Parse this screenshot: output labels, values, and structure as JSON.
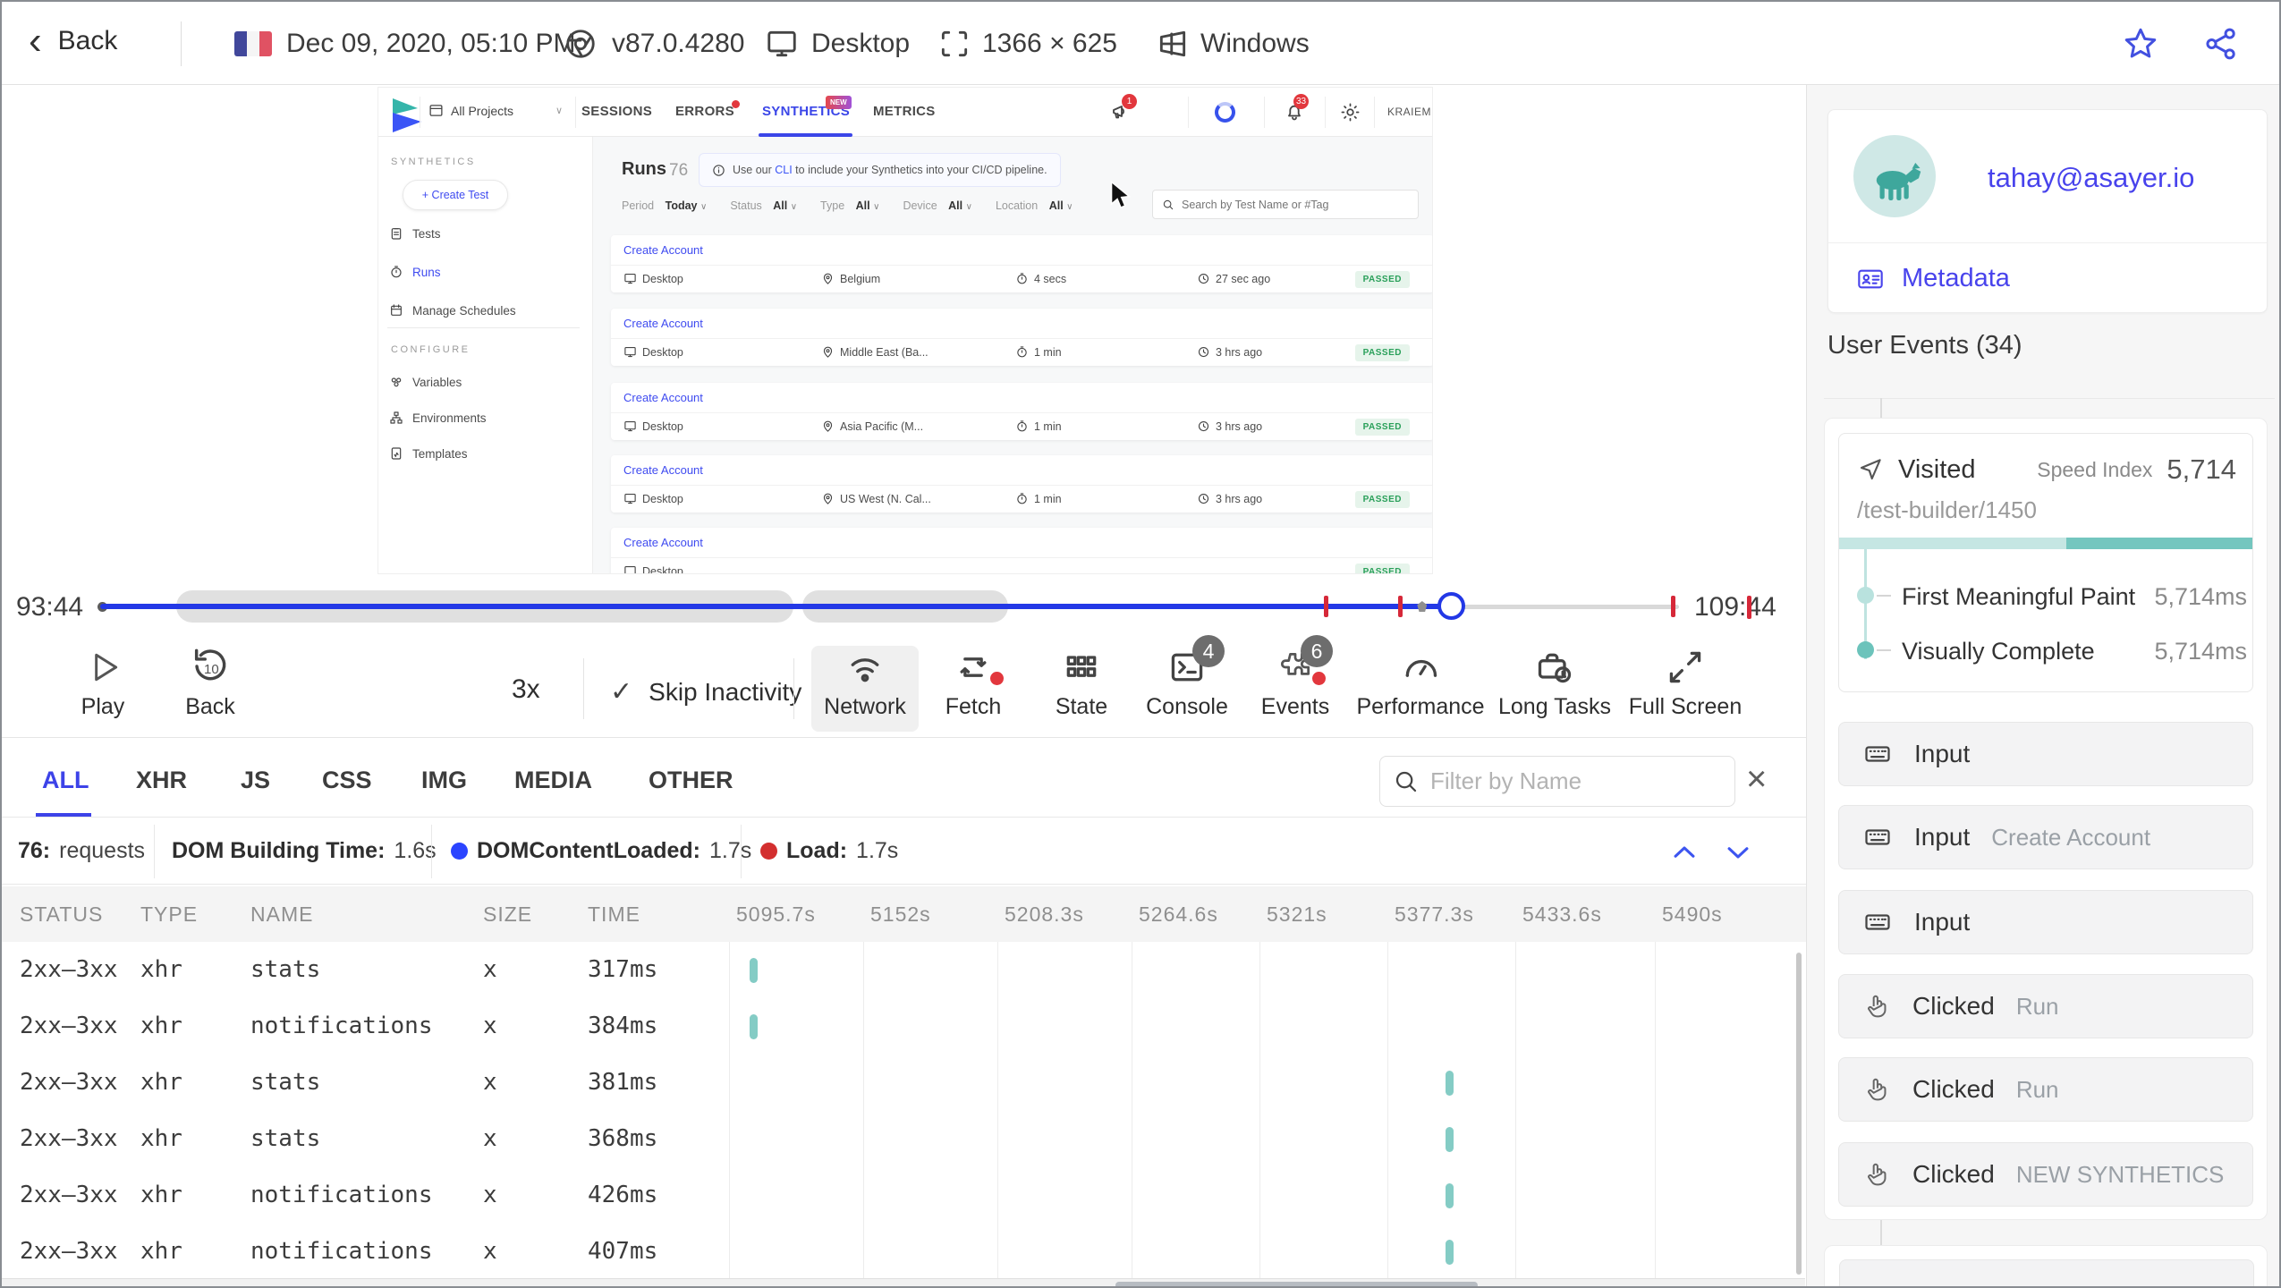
{
  "colors": {
    "accent_blue": "#3d43e8",
    "app_blue": "#3f4bf0",
    "timeline_blue": "#2338e6",
    "teal": "#84ccc5",
    "light_teal": "#c5e6e3",
    "red": "#d62839",
    "green": "#2aa05a"
  },
  "icons": {
    "back_chevron": "‹",
    "caret": "∨",
    "check": "✓",
    "kebab": "⋮",
    "close": "×",
    "info": "ⓘ",
    "plus": "+"
  },
  "top_bar": {
    "back_label": "Back",
    "date": "Dec 09, 2020, 05:10 PM",
    "browser_version": "v87.0.4280",
    "device": "Desktop",
    "resolution": "1366 × 625",
    "os": "Windows"
  },
  "replay_app": {
    "project_selector": "All Projects",
    "nav_tabs": [
      {
        "label": "SESSIONS"
      },
      {
        "label": "ERRORS"
      },
      {
        "label": "SYNTHETICS",
        "badge": "NEW"
      },
      {
        "label": "METRICS"
      }
    ],
    "announce_badge": "1",
    "bell_badge": "33",
    "user_name": "KRAIEM",
    "sidebar": {
      "section1": "SYNTHETICS",
      "create_button": "+ Create Test",
      "items": [
        "Tests",
        "Runs",
        "Manage Schedules"
      ],
      "section2": "CONFIGURE",
      "config_items": [
        "Variables",
        "Environments",
        "Templates"
      ]
    },
    "runs": {
      "title": "Runs",
      "count": "76",
      "banner_pre": "Use our ",
      "banner_link": "CLI",
      "banner_post": " to include your Synthetics into your CI/CD pipeline.",
      "filters": [
        {
          "label": "Period",
          "value": "Today"
        },
        {
          "label": "Status",
          "value": "All"
        },
        {
          "label": "Type",
          "value": "All"
        },
        {
          "label": "Device",
          "value": "All"
        },
        {
          "label": "Location",
          "value": "All"
        }
      ],
      "search_placeholder": "Search by Test Name or #Tag",
      "cards": [
        {
          "title": "Create Account",
          "device": "Desktop",
          "location": "Belgium",
          "duration": "4 secs",
          "ago": "27 sec ago",
          "status": "PASSED"
        },
        {
          "title": "Create Account",
          "device": "Desktop",
          "location": "Middle East (Ba...",
          "duration": "1 min",
          "ago": "3 hrs ago",
          "status": "PASSED"
        },
        {
          "title": "Create Account",
          "device": "Desktop",
          "location": "Asia Pacific (M...",
          "duration": "1 min",
          "ago": "3 hrs ago",
          "status": "PASSED"
        },
        {
          "title": "Create Account",
          "device": "Desktop",
          "location": "US West (N. Cal...",
          "duration": "1 min",
          "ago": "3 hrs ago",
          "status": "PASSED"
        },
        {
          "title": "Create Account",
          "device": "Desktop",
          "status": "PASSED"
        }
      ]
    }
  },
  "timeline": {
    "current_time": "93:44",
    "end_time": "109:44",
    "progress_pct": 85.6,
    "inactivity_bands_pct": [
      [
        4.8,
        43.9
      ],
      [
        44.5,
        57.5
      ]
    ],
    "event_markers_pct": [
      77.6,
      82.3
    ],
    "end_markers_pct": [
      99.6
    ],
    "gray_marker_pct": 83.7
  },
  "controls": {
    "play_label": "Play",
    "back_label": "Back",
    "back_amount": "10",
    "speed": "3x",
    "skip_label": "Skip Inactivity",
    "buttons": [
      {
        "label": "Network"
      },
      {
        "label": "Fetch"
      },
      {
        "label": "State"
      },
      {
        "label": "Console",
        "badge": "4"
      },
      {
        "label": "Events",
        "badge": "6"
      },
      {
        "label": "Performance"
      },
      {
        "label": "Long Tasks"
      },
      {
        "label": "Full Screen"
      }
    ]
  },
  "network_panel": {
    "tabs": [
      "ALL",
      "XHR",
      "JS",
      "CSS",
      "IMG",
      "MEDIA",
      "OTHER"
    ],
    "active_tab": "ALL",
    "filter_placeholder": "Filter by Name",
    "summary": {
      "requests_value": "76:",
      "requests_label": "requests",
      "dom_building_label": "DOM Building Time:",
      "dom_building_value": "1.6s",
      "dcl_label": "DOMContentLoaded:",
      "dcl_value": "1.7s",
      "load_label": "Load:",
      "load_value": "1.7s"
    },
    "columns": [
      "STATUS",
      "TYPE",
      "NAME",
      "SIZE",
      "TIME"
    ],
    "time_columns": [
      "5095.7s",
      "5152s",
      "5208.3s",
      "5264.6s",
      "5321s",
      "5377.3s",
      "5433.6s",
      "5490s"
    ],
    "rows": [
      {
        "status": "2xx–3xx",
        "type": "xhr",
        "name": "stats",
        "size": "x",
        "time": "317ms",
        "bar_col": 0,
        "bar_frac": 0.15
      },
      {
        "status": "2xx–3xx",
        "type": "xhr",
        "name": "notifications",
        "size": "x",
        "time": "384ms",
        "bar_col": 0,
        "bar_frac": 0.15
      },
      {
        "status": "2xx–3xx",
        "type": "xhr",
        "name": "stats",
        "size": "x",
        "time": "381ms",
        "bar_col": 5,
        "bar_frac": 0.43
      },
      {
        "status": "2xx–3xx",
        "type": "xhr",
        "name": "stats",
        "size": "x",
        "time": "368ms",
        "bar_col": 5,
        "bar_frac": 0.43
      },
      {
        "status": "2xx–3xx",
        "type": "xhr",
        "name": "notifications",
        "size": "x",
        "time": "426ms",
        "bar_col": 5,
        "bar_frac": 0.43
      },
      {
        "status": "2xx–3xx",
        "type": "xhr",
        "name": "notifications",
        "size": "x",
        "time": "407ms",
        "bar_col": 5,
        "bar_frac": 0.43
      }
    ]
  },
  "right_sidebar": {
    "email": "tahay@asayer.io",
    "metadata_label": "Metadata",
    "events_title": "User Events (34)",
    "visited": {
      "label": "Visited",
      "speed_index_label": "Speed Index",
      "speed_index_value": "5,714",
      "url": "/test-builder/1450",
      "metrics": [
        {
          "name": "First Meaningful Paint",
          "value": "5,714ms"
        },
        {
          "name": "Visually Complete",
          "value": "5,714ms"
        }
      ]
    },
    "events": [
      {
        "action": "Input",
        "target": ""
      },
      {
        "action": "Input",
        "target": "Create Account"
      },
      {
        "action": "Input",
        "target": ""
      },
      {
        "action": "Clicked",
        "target": "Run"
      },
      {
        "action": "Clicked",
        "target": "Run"
      },
      {
        "action": "Clicked",
        "target": "NEW SYNTHETICS"
      }
    ]
  }
}
